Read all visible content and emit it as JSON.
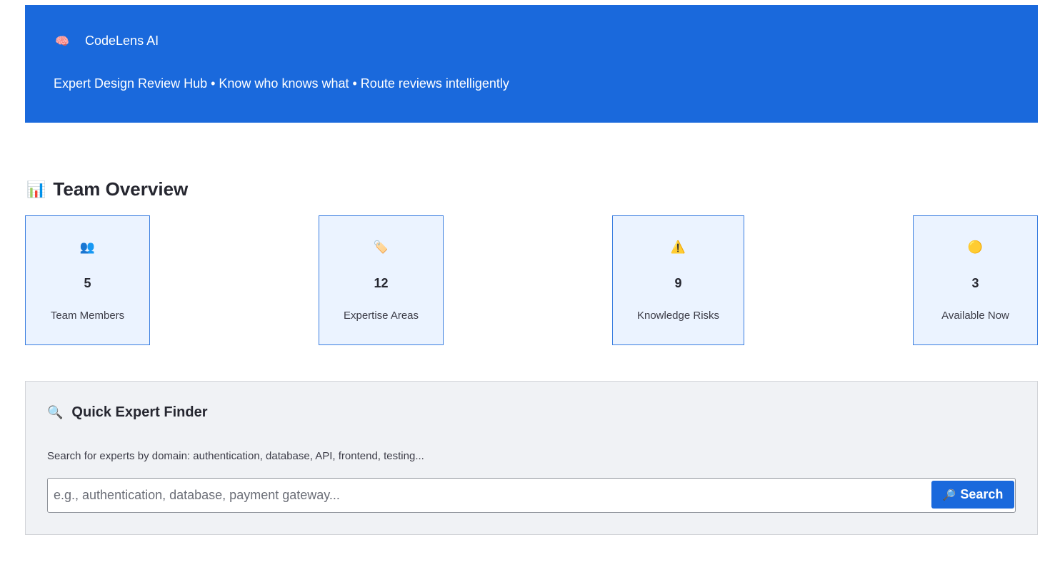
{
  "header": {
    "brand_icon": "brain-icon",
    "brand_glyph": "🧠",
    "title": "CodeLens AI",
    "tagline": "Expert Design Review Hub • Know who knows what • Route reviews intelligently",
    "background_color": "#1a69dc"
  },
  "overview": {
    "icon": "bar-chart-icon",
    "glyph": "📊",
    "title": "Team Overview",
    "cards": [
      {
        "icon": "team-icon",
        "glyph": "👥",
        "value": "5",
        "label": "Team Members"
      },
      {
        "icon": "tag-icon",
        "glyph": "🏷️",
        "value": "12",
        "label": "Expertise Areas"
      },
      {
        "icon": "warning-icon",
        "glyph": "⚠️",
        "value": "9",
        "label": "Knowledge Risks"
      },
      {
        "icon": "status-dot-icon",
        "glyph": "🟡",
        "value": "3",
        "label": "Available Now"
      }
    ]
  },
  "finder": {
    "icon": "magnifier-icon",
    "glyph": "🔍",
    "title": "Quick Expert Finder",
    "hint": "Search for experts by domain: authentication, database, API, frontend, testing...",
    "search": {
      "value": "",
      "placeholder": "e.g., authentication, database, payment gateway...",
      "button_icon": "search-icon",
      "button_glyph": "🔎",
      "button_label": "Search"
    }
  }
}
